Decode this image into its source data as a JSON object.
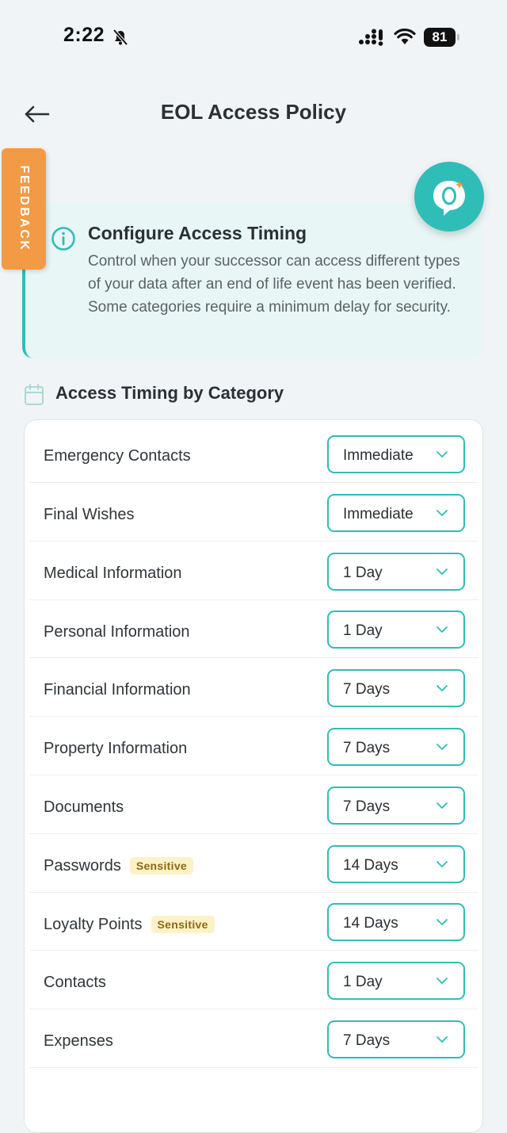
{
  "status_bar": {
    "time": "2:22",
    "battery": "81"
  },
  "header": {
    "title": "EOL Access Policy"
  },
  "feedback": {
    "label": "FEEDBACK"
  },
  "info_card": {
    "title": "Configure Access Timing",
    "body": "Control when your successor can access different types of your data after an end of life event has been verified. Some categories require a minimum delay for security."
  },
  "section": {
    "title": "Access Timing by Category"
  },
  "categories": [
    {
      "name": "Emergency Contacts",
      "badge": "",
      "timing": "Immediate"
    },
    {
      "name": "Final Wishes",
      "badge": "",
      "timing": "Immediate"
    },
    {
      "name": "Medical Information",
      "badge": "",
      "timing": "1 Day"
    },
    {
      "name": "Personal Information",
      "badge": "",
      "timing": "1 Day"
    },
    {
      "name": "Financial Information",
      "badge": "",
      "timing": "7 Days"
    },
    {
      "name": "Property Information",
      "badge": "",
      "timing": "7 Days"
    },
    {
      "name": "Documents",
      "badge": "",
      "timing": "7 Days"
    },
    {
      "name": "Passwords",
      "badge": "Sensitive",
      "timing": "14 Days"
    },
    {
      "name": "Loyalty Points",
      "badge": "Sensitive",
      "timing": "14 Days"
    },
    {
      "name": "Contacts",
      "badge": "",
      "timing": "1 Day"
    },
    {
      "name": "Expenses",
      "badge": "",
      "timing": "7 Days"
    }
  ],
  "colors": {
    "accent": "#2fbdb8",
    "feedback": "#f39a45",
    "badge_bg": "#fdf1c7",
    "badge_text": "#8a6a14",
    "info_bg": "#e8f6f5"
  }
}
